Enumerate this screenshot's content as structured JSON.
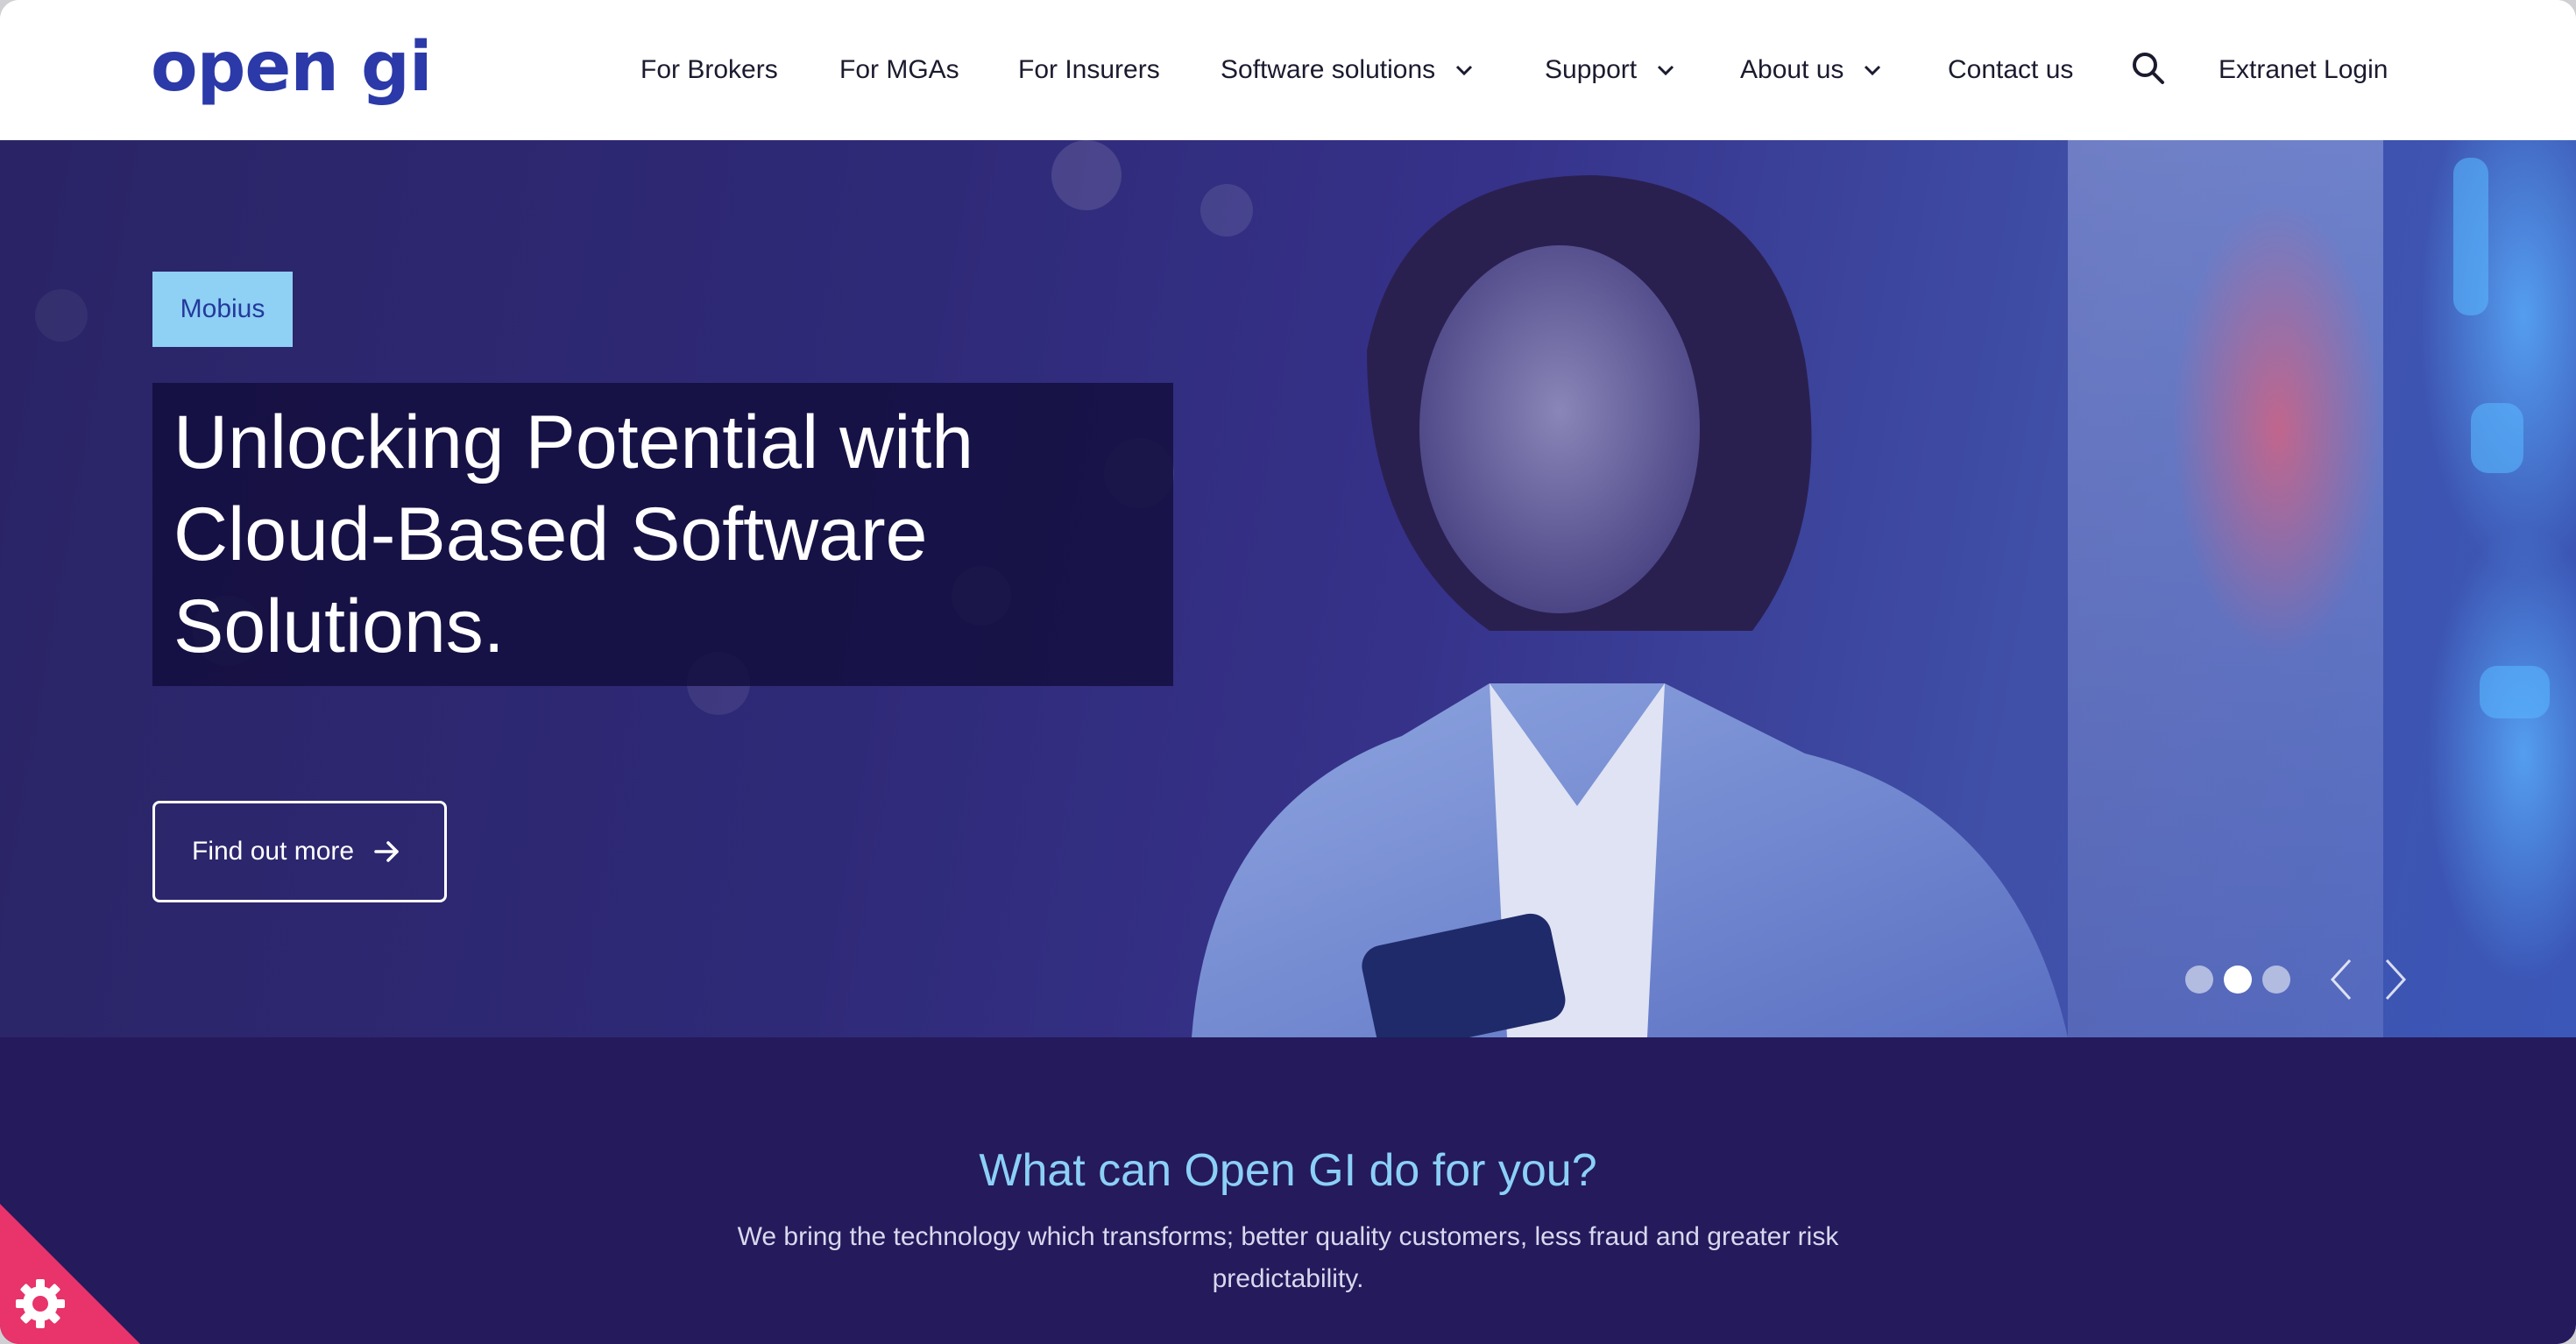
{
  "header": {
    "logo": "open gi",
    "nav": [
      {
        "label": "For Brokers",
        "dropdown": false
      },
      {
        "label": "For MGAs",
        "dropdown": false
      },
      {
        "label": "For Insurers",
        "dropdown": false
      },
      {
        "label": "Software solutions",
        "dropdown": true
      },
      {
        "label": "Support",
        "dropdown": true
      },
      {
        "label": "About us",
        "dropdown": true
      },
      {
        "label": "Contact us",
        "dropdown": false
      }
    ],
    "search_icon": "search-icon",
    "login_label": "Extranet Login"
  },
  "hero": {
    "tag": "Mobius",
    "headline": "Unlocking Potential with Cloud-Based Software Solutions.",
    "cta_label": "Find out more",
    "carousel": {
      "slides": 3,
      "active_index": 1
    }
  },
  "intro": {
    "title": "What can Open GI do for you?",
    "text": "We bring the technology which transforms; better quality customers, less fraud and greater risk predictability."
  },
  "colors": {
    "brand_blue": "#2b3aa8",
    "tag_bg": "#8fd0f5",
    "intro_bg": "#241a5c",
    "intro_title": "#8cd0f6",
    "cookie_pink": "#e8336b"
  },
  "cookie_icon": "cookie-settings-icon"
}
